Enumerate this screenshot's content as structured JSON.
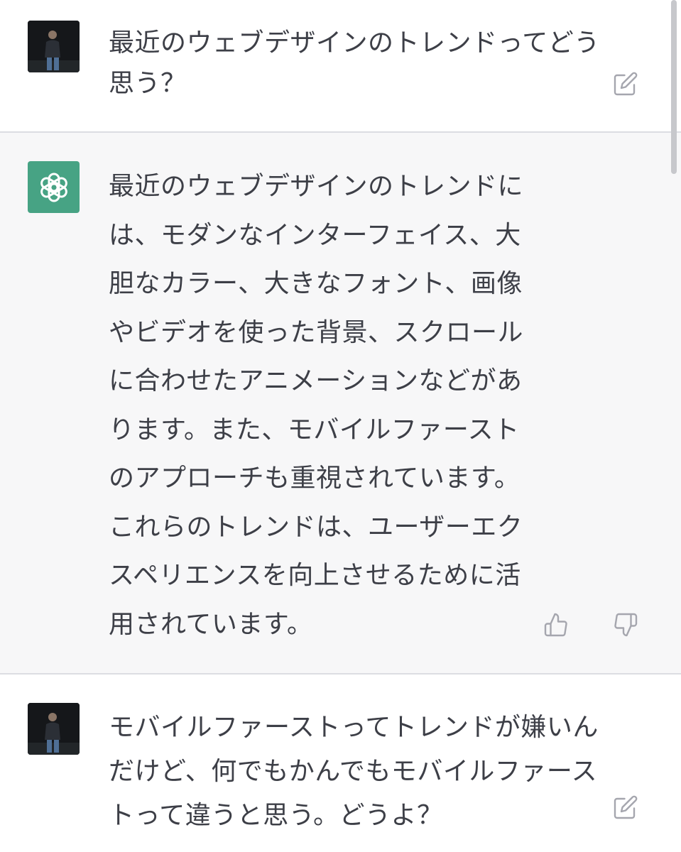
{
  "conversation": {
    "messages": [
      {
        "role": "user",
        "text": "最近のウェブデザインのトレンドってどう\n思う？"
      },
      {
        "role": "assistant",
        "text": "最近のウェブデザインのトレンドに\nは、モダンなインターフェイス、大\n胆なカラー、大きなフォント、画像\nやビデオを使った背景、スクロール\nに合わせたアニメーションなどがあ\nります。また、モバイルファースト\nのアプローチも重視されています。\nこれらのトレンドは、ユーザーエク\nスペリエンスを向上させるために活\n用されています。"
      },
      {
        "role": "user",
        "text": "モバイルファーストってトレンドが嫌いん\nだけど、何でもかんでもモバイルファース\nトって違うと思う。どうよ？"
      }
    ]
  },
  "icons": {
    "user_avatar": "user-avatar",
    "assistant_avatar": "openai-logo-icon",
    "edit": "edit-icon",
    "thumbs_up": "thumbs-up-icon",
    "thumbs_down": "thumbs-down-icon"
  },
  "colors": {
    "assistant_avatar_bg": "#47a384",
    "assistant_bg": "#f7f7f8",
    "text": "#3d3f47",
    "icon": "#a5a6ae"
  }
}
